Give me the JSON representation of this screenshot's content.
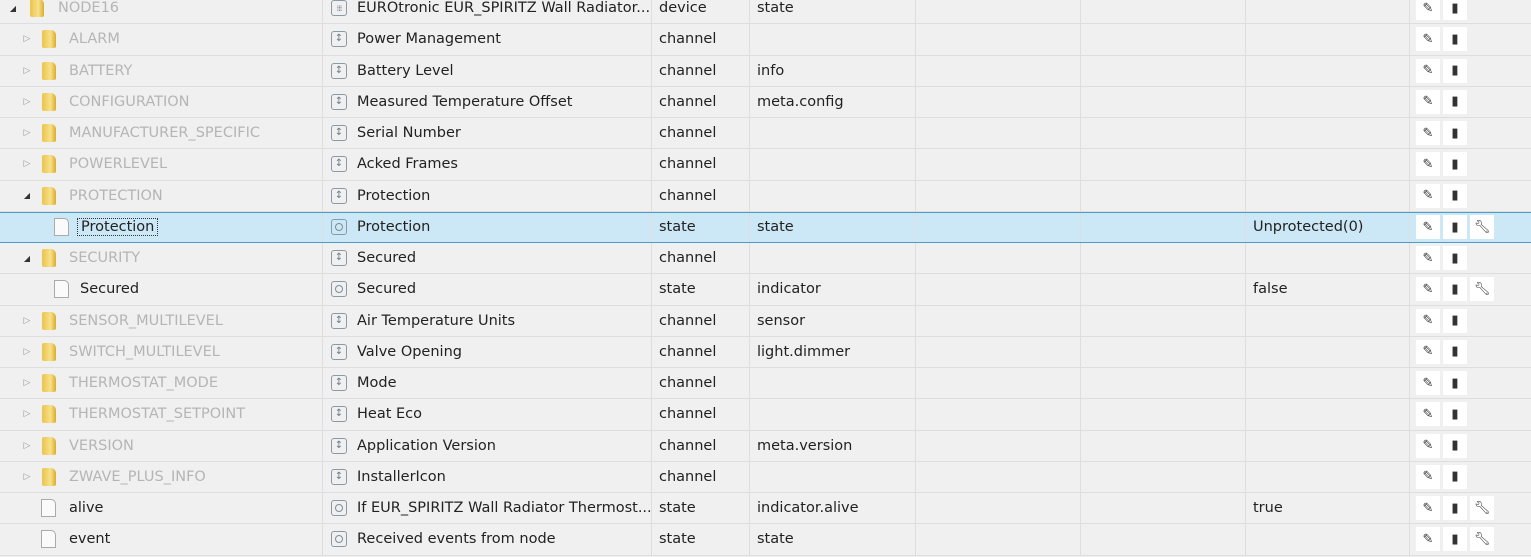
{
  "rows": [
    {
      "name": "NODE16",
      "level": 0,
      "kind": "folder",
      "expanded": true,
      "obj_icon": "device",
      "obj_name": "EUROtronic EUR_SPIRITZ Wall Radiator...",
      "type": "device",
      "role": "state",
      "value": "",
      "wrench": false
    },
    {
      "name": "ALARM",
      "level": 1,
      "kind": "folder",
      "expanded": false,
      "obj_icon": "channel",
      "obj_name": "Power Management",
      "type": "channel",
      "role": "",
      "value": "",
      "wrench": false
    },
    {
      "name": "BATTERY",
      "level": 1,
      "kind": "folder",
      "expanded": false,
      "obj_icon": "channel",
      "obj_name": "Battery Level",
      "type": "channel",
      "role": "info",
      "value": "",
      "wrench": false
    },
    {
      "name": "CONFIGURATION",
      "level": 1,
      "kind": "folder",
      "expanded": false,
      "obj_icon": "channel",
      "obj_name": "Measured Temperature Offset",
      "type": "channel",
      "role": "meta.config",
      "value": "",
      "wrench": false
    },
    {
      "name": "MANUFACTURER_SPECIFIC",
      "level": 1,
      "kind": "folder",
      "expanded": false,
      "obj_icon": "channel",
      "obj_name": "Serial Number",
      "type": "channel",
      "role": "",
      "value": "",
      "wrench": false
    },
    {
      "name": "POWERLEVEL",
      "level": 1,
      "kind": "folder",
      "expanded": false,
      "obj_icon": "channel",
      "obj_name": "Acked Frames",
      "type": "channel",
      "role": "",
      "value": "",
      "wrench": false
    },
    {
      "name": "PROTECTION",
      "level": 1,
      "kind": "folder",
      "expanded": true,
      "obj_icon": "channel",
      "obj_name": "Protection",
      "type": "channel",
      "role": "",
      "value": "",
      "wrench": false
    },
    {
      "name": "Protection",
      "level": 2,
      "kind": "file",
      "selected": true,
      "obj_icon": "state",
      "obj_name": "Protection",
      "type": "state",
      "role": "state",
      "value": "Unprotected(0)",
      "wrench": true
    },
    {
      "name": "SECURITY",
      "level": 1,
      "kind": "folder",
      "expanded": true,
      "obj_icon": "channel",
      "obj_name": "Secured",
      "type": "channel",
      "role": "",
      "value": "",
      "wrench": false
    },
    {
      "name": "Secured",
      "level": 2,
      "kind": "file",
      "obj_icon": "state",
      "obj_name": "Secured",
      "type": "state",
      "role": "indicator",
      "value": "false",
      "wrench": true
    },
    {
      "name": "SENSOR_MULTILEVEL",
      "level": 1,
      "kind": "folder",
      "expanded": false,
      "obj_icon": "channel",
      "obj_name": "Air Temperature Units",
      "type": "channel",
      "role": "sensor",
      "value": "",
      "wrench": false
    },
    {
      "name": "SWITCH_MULTILEVEL",
      "level": 1,
      "kind": "folder",
      "expanded": false,
      "obj_icon": "channel",
      "obj_name": "Valve Opening",
      "type": "channel",
      "role": "light.dimmer",
      "value": "",
      "wrench": false
    },
    {
      "name": "THERMOSTAT_MODE",
      "level": 1,
      "kind": "folder",
      "expanded": false,
      "obj_icon": "channel",
      "obj_name": "Mode",
      "type": "channel",
      "role": "",
      "value": "",
      "wrench": false
    },
    {
      "name": "THERMOSTAT_SETPOINT",
      "level": 1,
      "kind": "folder",
      "expanded": false,
      "obj_icon": "channel",
      "obj_name": "Heat Eco",
      "type": "channel",
      "role": "",
      "value": "",
      "wrench": false
    },
    {
      "name": "VERSION",
      "level": 1,
      "kind": "folder",
      "expanded": false,
      "obj_icon": "channel",
      "obj_name": "Application Version",
      "type": "channel",
      "role": "meta.version",
      "value": "",
      "wrench": false
    },
    {
      "name": "ZWAVE_PLUS_INFO",
      "level": 1,
      "kind": "folder",
      "expanded": false,
      "obj_icon": "channel",
      "obj_name": "InstallerIcon",
      "type": "channel",
      "role": "",
      "value": "",
      "wrench": false
    },
    {
      "name": "alive",
      "level": 1,
      "kind": "file",
      "obj_icon": "state",
      "obj_name": "If EUR_SPIRITZ Wall Radiator Thermost...",
      "type": "state",
      "role": "indicator.alive",
      "value": "true",
      "wrench": true
    },
    {
      "name": "event",
      "level": 1,
      "kind": "file",
      "obj_icon": "state",
      "obj_name": "Received events from node",
      "type": "state",
      "role": "state",
      "value": "",
      "wrench": true
    }
  ],
  "icons": {
    "edit": "pencil-icon",
    "delete": "trash-icon",
    "settings": "wrench-icon"
  },
  "colors": {
    "selected_row": "#cce7f5",
    "selected_border": "#4a9cc9",
    "folder": "#e9c44a"
  }
}
